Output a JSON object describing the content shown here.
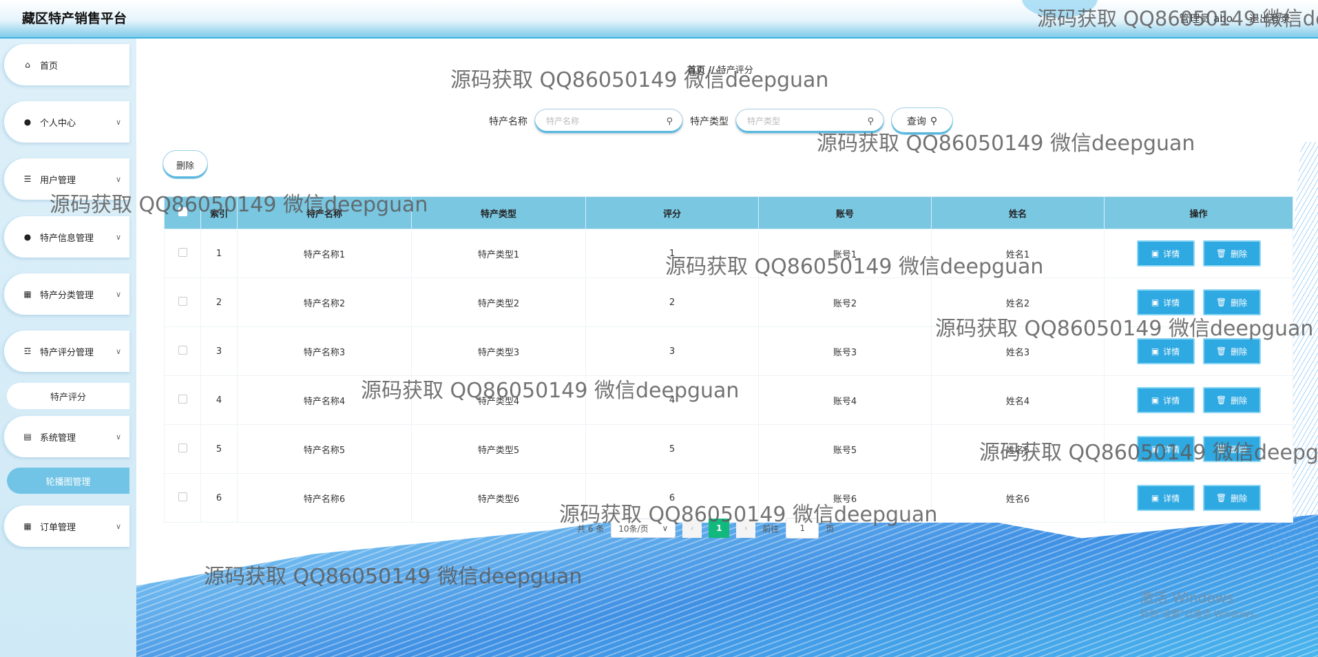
{
  "header": {
    "title": "藏区特产销售平台",
    "user_label": "管理员 abo",
    "logout_label": "退出登录"
  },
  "sidebar": {
    "items": [
      {
        "label": "首页",
        "icon": "home-icon",
        "glyph": "⌂",
        "chev": ""
      },
      {
        "label": "个人中心",
        "icon": "user-icon",
        "glyph": "●",
        "chev": "∨"
      },
      {
        "label": "用户管理",
        "icon": "list-icon",
        "glyph": "☰",
        "chev": "∨"
      },
      {
        "label": "特产信息管理",
        "icon": "user-icon",
        "glyph": "●",
        "chev": "∨"
      },
      {
        "label": "特产分类管理",
        "icon": "grid-icon",
        "glyph": "▦",
        "chev": "∨"
      },
      {
        "label": "特产评分管理",
        "icon": "sliders-icon",
        "glyph": "☲",
        "chev": "∨"
      },
      {
        "label": "系统管理",
        "icon": "clipboard-icon",
        "glyph": "▤",
        "chev": "∨"
      },
      {
        "label": "订单管理",
        "icon": "grid-icon",
        "glyph": "▦",
        "chev": "∨"
      }
    ],
    "sub_rating": "特产评分",
    "sub_carousel": "轮播图管理"
  },
  "breadcrumb": {
    "home": "首页",
    "sep": "//",
    "current": "特产评分"
  },
  "search": {
    "name_label": "特产名称",
    "name_placeholder": "特产名称",
    "type_label": "特产类型",
    "type_placeholder": "特产类型",
    "query_label": "查询"
  },
  "delete_label": "删除",
  "table": {
    "headers": [
      "索引",
      "特产名称",
      "特产类型",
      "评分",
      "账号",
      "姓名",
      "操作"
    ],
    "rows": [
      {
        "index": "1",
        "name": "特产名称1",
        "type": "特产类型1",
        "score": "1",
        "account": "账号1",
        "person": "姓名1"
      },
      {
        "index": "2",
        "name": "特产名称2",
        "type": "特产类型2",
        "score": "2",
        "account": "账号2",
        "person": "姓名2"
      },
      {
        "index": "3",
        "name": "特产名称3",
        "type": "特产类型3",
        "score": "3",
        "account": "账号3",
        "person": "姓名3"
      },
      {
        "index": "4",
        "name": "特产名称4",
        "type": "特产类型4",
        "score": "4",
        "account": "账号4",
        "person": "姓名4"
      },
      {
        "index": "5",
        "name": "特产名称5",
        "type": "特产类型5",
        "score": "5",
        "account": "账号5",
        "person": "姓名5"
      },
      {
        "index": "6",
        "name": "特产名称6",
        "type": "特产类型6",
        "score": "6",
        "account": "账号6",
        "person": "姓名6"
      }
    ],
    "detail_label": "详情",
    "row_delete_label": "删除"
  },
  "pager": {
    "total": "共 6 条",
    "size": "10条/页",
    "current": "1",
    "goto": "前往",
    "goto_value": "1",
    "page_unit": "页"
  },
  "watermark": "源码获取 QQ86050149 微信deepguan",
  "activate": {
    "line1": "激活 Windows",
    "line2": "转到\"设置\"以激活 Windows。"
  }
}
